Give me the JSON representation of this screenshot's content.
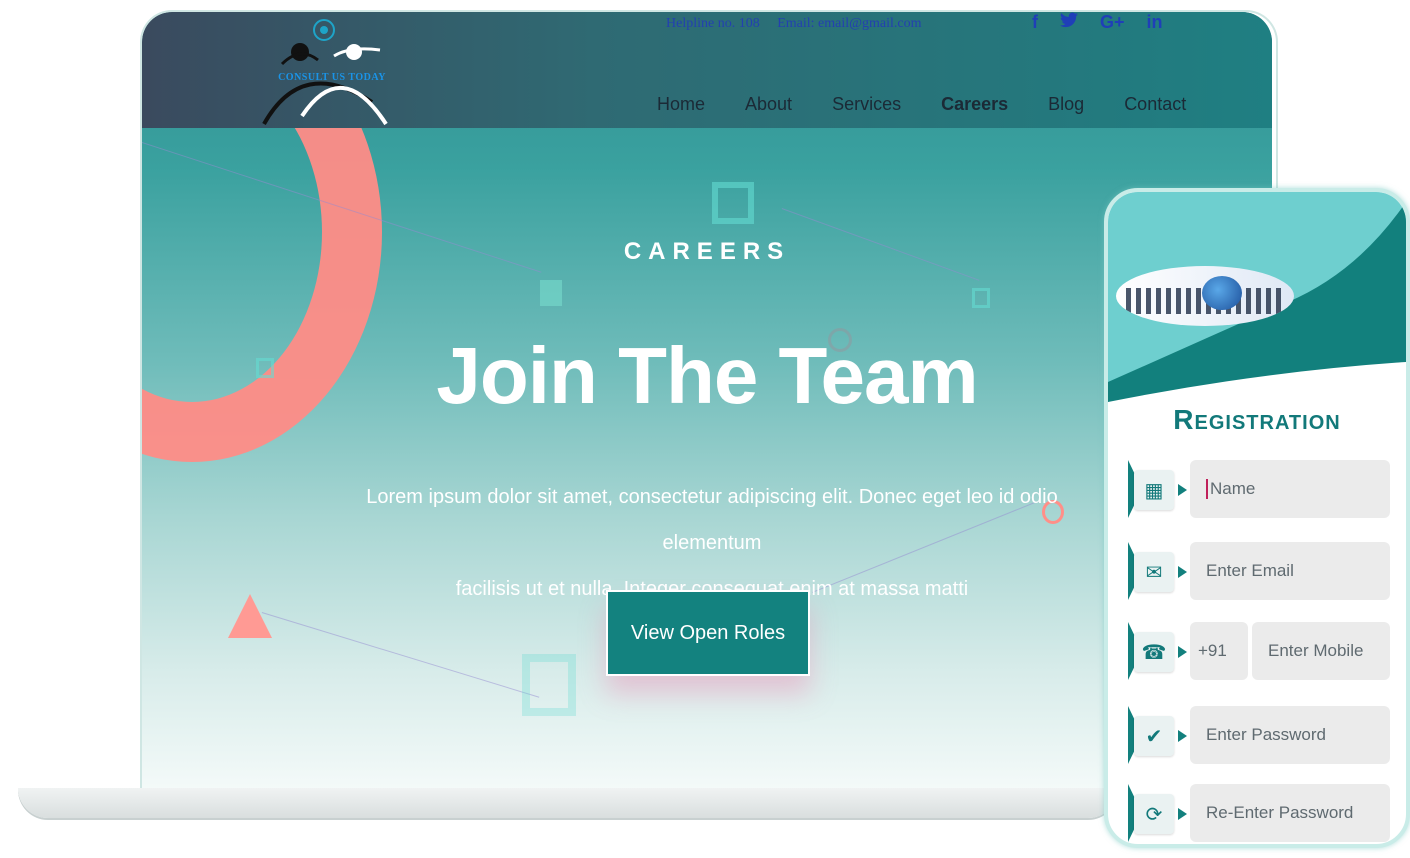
{
  "header": {
    "logo_text": "CONSULT US TODAY",
    "helpline": "Helpline no. 108",
    "email": "Email: email@gmail.com",
    "socials": [
      {
        "icon": "facebook-icon",
        "glyph": "f"
      },
      {
        "icon": "twitter-icon",
        "glyph": "🐦"
      },
      {
        "icon": "google-plus-icon",
        "glyph": "G+"
      },
      {
        "icon": "linkedin-icon",
        "glyph": "in"
      }
    ],
    "nav": [
      "Home",
      "About",
      "Services",
      "Careers",
      "Blog",
      "Contact"
    ],
    "active_nav": "Careers"
  },
  "hero": {
    "eyebrow": "CAREERS",
    "title": "Join The Team",
    "text_line1": "Lorem ipsum dolor sit amet, consectetur adipiscing elit. Donec eget leo id odio elementum",
    "text_line2": "facilisis ut et nulla. Integer consequat enim at massa matti",
    "button": "View Open Roles"
  },
  "registration": {
    "title": "Registration",
    "fields": {
      "name": "Name",
      "email": "Enter Email",
      "country_code": "+91",
      "mobile": "Enter Mobile",
      "password": "Enter Password",
      "repassword": "Re-Enter Password"
    }
  },
  "colors": {
    "primary": "#13827f",
    "accent_coral": "#ff8d87",
    "nav_dark": "#3a4a5e",
    "title_teal": "#12797a"
  }
}
